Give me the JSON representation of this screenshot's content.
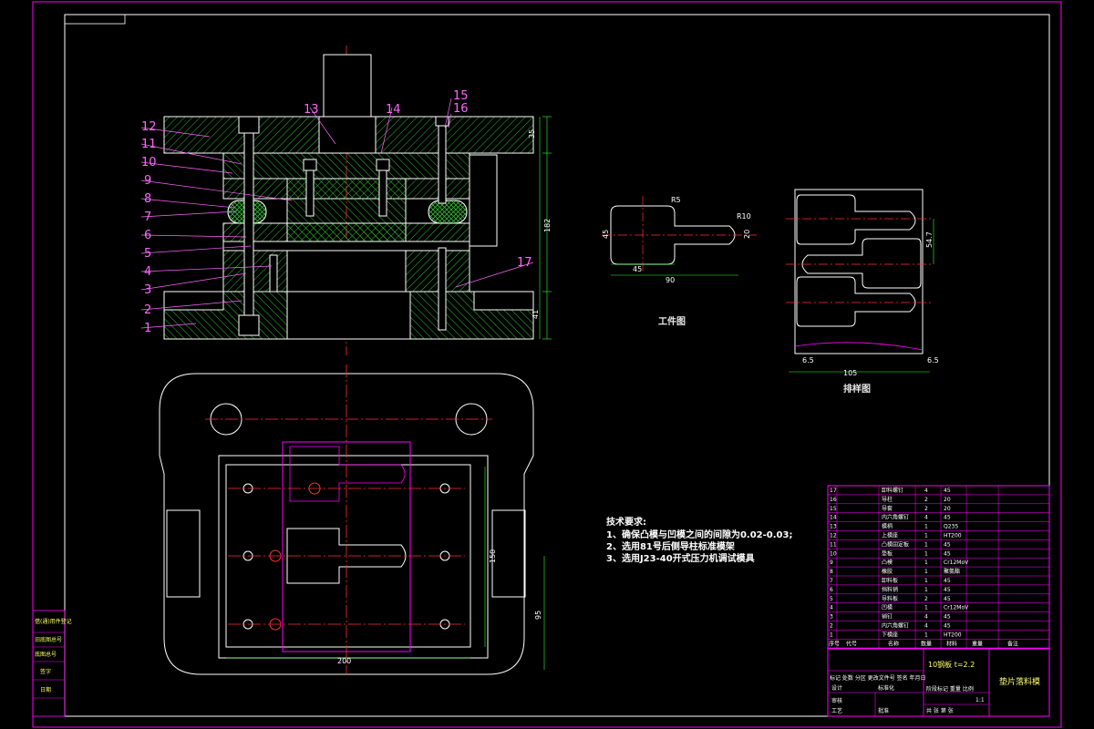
{
  "drawing": {
    "part_numbers": [
      "1",
      "2",
      "3",
      "4",
      "5",
      "6",
      "7",
      "8",
      "9",
      "10",
      "11",
      "12",
      "13",
      "14",
      "15",
      "16",
      "17"
    ],
    "workpiece_title": "工件图",
    "layout_title": "排样图",
    "tech_title": "技术要求:",
    "tech_lines": [
      "1、确保凸模与凹模之间的间隙为0.02-0.03;",
      "2、选用81号后侧导柱标准模架",
      "3、选用J23-40开式压力机调试模具"
    ],
    "workpiece_dims": {
      "r5": "R5",
      "r10": "R10",
      "h20": "20",
      "w90": "90",
      "w45": "45",
      "h45": "45"
    },
    "layout_dims": {
      "pitch": "54.7",
      "left": "6.5",
      "right": "6.5",
      "width": "105"
    },
    "section_dims": {
      "d35": "35",
      "d182": "182",
      "d41": "41"
    },
    "plan_dims": {
      "w200": "200",
      "h150": "150",
      "h95": "95"
    },
    "title_block": {
      "material": "10钢板  t=2.2",
      "drawing_name": "垫片落料模",
      "scale": "1:1",
      "row_a": "标记 处数 分区 更改文件号 签名 年月日",
      "row_b": "设计",
      "row_c": "审核",
      "row_d": "工艺",
      "row_e": "批准",
      "sheet_info": "共  张  第  张",
      "stage": "阶段标记  重量  比例",
      "standardize": "标准化",
      "headers": [
        "序号",
        "代号",
        "名称",
        "数量",
        "材料",
        "重量",
        "备注"
      ]
    },
    "side_block": [
      "借(通)用件登记",
      "旧底图总号",
      "底图总号",
      "签字",
      "日期"
    ],
    "bom": [
      {
        "no": "17",
        "name": "卸料螺钉",
        "qty": "4",
        "mat": "45"
      },
      {
        "no": "16",
        "name": "导柱",
        "qty": "2",
        "mat": "20"
      },
      {
        "no": "15",
        "name": "导套",
        "qty": "2",
        "mat": "20"
      },
      {
        "no": "14",
        "name": "内六角螺钉",
        "qty": "4",
        "mat": "45"
      },
      {
        "no": "13",
        "name": "模柄",
        "qty": "1",
        "mat": "Q235"
      },
      {
        "no": "12",
        "name": "上模座",
        "qty": "1",
        "mat": "HT200"
      },
      {
        "no": "11",
        "name": "凸模固定板",
        "qty": "1",
        "mat": "45"
      },
      {
        "no": "10",
        "name": "垫板",
        "qty": "1",
        "mat": "45"
      },
      {
        "no": "9",
        "name": "凸模",
        "qty": "1",
        "mat": "Cr12MoV"
      },
      {
        "no": "8",
        "name": "橡胶",
        "qty": "1",
        "mat": "聚氨酯"
      },
      {
        "no": "7",
        "name": "卸料板",
        "qty": "1",
        "mat": "45"
      },
      {
        "no": "6",
        "name": "挡料销",
        "qty": "1",
        "mat": "45"
      },
      {
        "no": "5",
        "name": "导料板",
        "qty": "2",
        "mat": "45"
      },
      {
        "no": "4",
        "name": "凹模",
        "qty": "1",
        "mat": "Cr12MoV"
      },
      {
        "no": "3",
        "name": "销钉",
        "qty": "4",
        "mat": "45"
      },
      {
        "no": "2",
        "name": "内六角螺钉",
        "qty": "4",
        "mat": "45"
      },
      {
        "no": "1",
        "name": "下模座",
        "qty": "1",
        "mat": "HT200"
      }
    ],
    "colors": {
      "bg": "#000000",
      "frame": "#ff00ff",
      "line": "#ffffff",
      "center": "#ff3030",
      "dim": "#33ff33",
      "hatch": "#33cc33",
      "table": "#ff00ff",
      "label": "#ff66ff"
    }
  }
}
